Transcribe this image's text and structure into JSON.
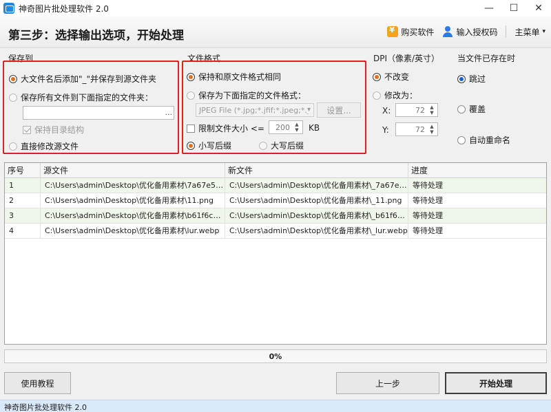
{
  "window": {
    "title": "神奇图片批处理软件 2.0",
    "minimize": "—",
    "maximize": "☐",
    "close": "✕"
  },
  "header": {
    "step_title": "第三步：选择输出选项，开始处理",
    "buy": "购买软件",
    "license": "输入授权码",
    "main_menu": "主菜单",
    "main_menu_caret": "▾"
  },
  "save_to": {
    "label": "保存到",
    "option_append": "大文件名后添加\"_\"并保存到源文件夹",
    "option_folder": "保存所有文件到下面指定的文件夹：",
    "folder_value": "",
    "browse": "...",
    "keep_structure": "保持目录结构",
    "option_overwrite": "直接修改源文件"
  },
  "file_format": {
    "label": "文件格式",
    "option_same": "保持和原文件格式相同",
    "option_save_as": "保存为下面指定的文件格式：",
    "format_select": "JPEG File (*.jpg;*.jfif;*.jpeg;*.j",
    "settings": "设置...",
    "limit_size": "限制文件大小 <=",
    "limit_value": "200",
    "limit_unit": "KB",
    "lower_suffix": "小写后缀",
    "upper_suffix": "大写后缀"
  },
  "dpi": {
    "label": "DPI（像素/英寸）",
    "no_change": "不改变",
    "change_to": "修改为：",
    "x_label": "X:",
    "x_value": "72",
    "y_label": "Y:",
    "y_value": "72"
  },
  "file_exists": {
    "label": "当文件已存在时",
    "skip": "跳过",
    "overwrite": "覆盖",
    "auto_rename": "自动重命名"
  },
  "table": {
    "columns": [
      "序号",
      "源文件",
      "新文件",
      "进度"
    ],
    "rows": [
      [
        "1",
        "C:\\Users\\admin\\Desktop\\优化备用素材\\7a67e5694...",
        "C:\\Users\\admin\\Desktop\\优化备用素材\\_7a67e569...",
        "等待处理"
      ],
      [
        "2",
        "C:\\Users\\admin\\Desktop\\优化备用素材\\11.png",
        "C:\\Users\\admin\\Desktop\\优化备用素材\\_11.png",
        "等待处理"
      ],
      [
        "3",
        "C:\\Users\\admin\\Desktop\\优化备用素材\\b61f6c8fda...",
        "C:\\Users\\admin\\Desktop\\优化备用素材\\_b61f6c8f...",
        "等待处理"
      ],
      [
        "4",
        "C:\\Users\\admin\\Desktop\\优化备用素材\\lur.webp",
        "C:\\Users\\admin\\Desktop\\优化备用素材\\_lur.webp",
        "等待处理"
      ]
    ]
  },
  "progress": {
    "text": "0%",
    "fraction": 0
  },
  "buttons": {
    "tutorial": "使用教程",
    "prev": "上一步",
    "start": "开始处理"
  },
  "statusbar": {
    "text": "神奇图片批处理软件 2.0"
  },
  "colors": {
    "highlight_box": "#e02020",
    "radio_selected": "#e07020",
    "progress_fill": "#06b025",
    "row_alt": "#eef7ea",
    "statusbar": "#d9e9f9"
  }
}
